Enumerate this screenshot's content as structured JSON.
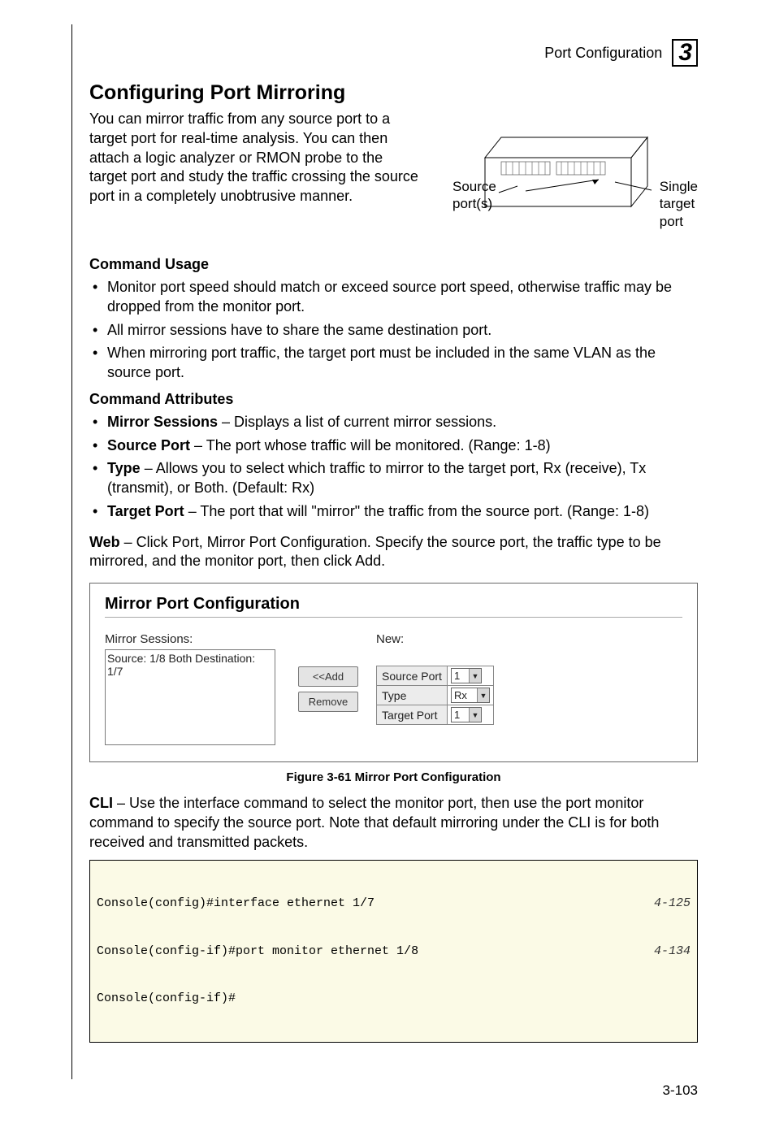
{
  "header": {
    "section": "Port Configuration",
    "chapter_number": "3"
  },
  "title": "Configuring Port Mirroring",
  "intro": "You can mirror traffic from any source port to a target port for real-time analysis. You can then attach a logic analyzer or RMON probe to the target port and study the traffic crossing the source port in a completely unobtrusive manner.",
  "diagram": {
    "left_label_line1": "Source",
    "left_label_line2": "port(s)",
    "right_label_line1": "Single",
    "right_label_line2": "target",
    "right_label_line3": "port"
  },
  "usage_heading": "Command Usage",
  "usage_bullets": [
    "Monitor port speed should match or exceed source port speed, otherwise traffic may be dropped from the monitor port.",
    "All mirror sessions have to share the same destination port.",
    "When mirroring port traffic, the target port must be included in the same VLAN as the source port."
  ],
  "attr_heading": "Command Attributes",
  "attr_bullets": [
    {
      "term": "Mirror Sessions",
      "desc": " – Displays a list of current mirror sessions."
    },
    {
      "term": "Source Port",
      "desc": " – The port whose traffic will be monitored. (Range: 1-8)"
    },
    {
      "term": "Type",
      "desc": " – Allows you to select which traffic to mirror to the target port, Rx (receive), Tx (transmit), or Both. (Default: Rx)"
    },
    {
      "term": "Target Port",
      "desc": " – The port that will \"mirror\" the traffic from the source port. (Range: 1-8)"
    }
  ],
  "web_prefix": "Web",
  "web_text": " – Click Port, Mirror Port Configuration. Specify the source port, the traffic type to be mirrored, and the monitor port, then click Add.",
  "figure": {
    "panel_title": "Mirror Port Configuration",
    "mirror_sessions_label": "Mirror Sessions:",
    "mirror_sessions_value": "Source: 1/8 Both Destination: 1/7",
    "btn_add": "<<Add",
    "btn_remove": "Remove",
    "new_label": "New:",
    "source_port_label": "Source Port",
    "source_port_value": "1",
    "type_label": "Type",
    "type_value": "Rx",
    "target_port_label": "Target Port",
    "target_port_value": "1",
    "caption": "Figure 3-61   Mirror Port Configuration"
  },
  "cli_prefix": "CLI",
  "cli_text": " – Use the interface command to select the monitor port, then use the port monitor command to specify the source port. Note that default mirroring under the CLI is for both received and transmitted packets.",
  "cli_lines": [
    {
      "cmd": "Console(config)#interface ethernet 1/7",
      "ref": "4-125"
    },
    {
      "cmd": "Console(config-if)#port monitor ethernet 1/8",
      "ref": "4-134"
    },
    {
      "cmd": "Console(config-if)#",
      "ref": ""
    }
  ],
  "page_number": "3-103"
}
